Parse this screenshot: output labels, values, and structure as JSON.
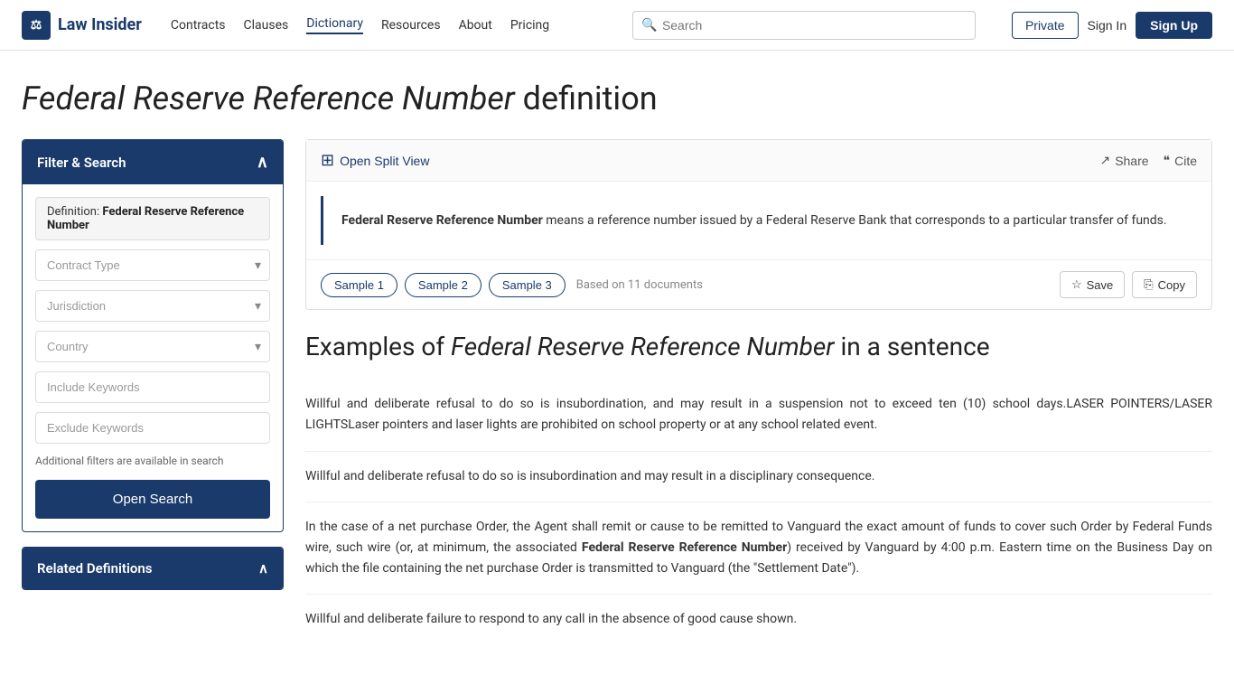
{
  "nav": {
    "logo_text": "Law Insider",
    "logo_icon": "⚖",
    "links": [
      {
        "label": "Contracts",
        "active": false
      },
      {
        "label": "Clauses",
        "active": false
      },
      {
        "label": "Dictionary",
        "active": true
      },
      {
        "label": "Resources",
        "active": false
      },
      {
        "label": "About",
        "active": false
      },
      {
        "label": "Pricing",
        "active": false
      }
    ],
    "search_placeholder": "Search",
    "btn_private": "Private",
    "btn_signin": "Sign In",
    "btn_signup": "Sign Up"
  },
  "page": {
    "title_italic": "Federal Reserve Reference Number",
    "title_suffix": " definition"
  },
  "sidebar": {
    "filter_title": "Filter & Search",
    "definition_label": "Definition:",
    "definition_value": "Federal Reserve Reference Number",
    "contract_type_placeholder": "Contract Type",
    "jurisdiction_placeholder": "Jurisdiction",
    "country_placeholder": "Country",
    "include_keywords_placeholder": "Include Keywords",
    "exclude_keywords_placeholder": "Exclude Keywords",
    "filter_hint": "Additional filters are available in search",
    "open_search_label": "Open Search",
    "related_title": "Related Definitions"
  },
  "content": {
    "split_view_label": "Open Split View",
    "share_label": "Share",
    "cite_label": "Cite",
    "definition_text_bold": "Federal Reserve Reference Number",
    "definition_text_rest": " means a reference number issued by a Federal Reserve Bank that corresponds to a particular transfer of funds.",
    "samples": [
      "Sample 1",
      "Sample 2",
      "Sample 3"
    ],
    "based_on": "Based on 11 documents",
    "save_label": "Save",
    "copy_label": "Copy",
    "examples_title_prefix": "Examples of ",
    "examples_title_italic": "Federal Reserve Reference Number",
    "examples_title_suffix": " in a sentence",
    "examples": [
      "Willful and deliberate refusal to do so is insubordination, and may result in a suspension not to exceed ten (10) school days.LASER POINTERS/LASER LIGHTSLaser pointers and laser lights are prohibited on school property or at any school related event.",
      "Willful and deliberate refusal to do so is insubordination and may result in a disciplinary consequence.",
      "In the case of a net purchase Order, the Agent shall remit or cause to be remitted to Vanguard the exact amount of funds to cover such Order by Federal Funds wire, such wire (or, at minimum, the associated Federal Reserve Reference Number) received by Vanguard by 4:00 p.m. Eastern time on the Business Day on which the file containing the net purchase Order is transmitted to Vanguard (the \"Settlement Date\").",
      "Willful and deliberate failure to respond to any call in the absence of good cause shown."
    ],
    "example_bold_phrase": "Federal Reserve Reference Number"
  },
  "icons": {
    "chevron_up": "∧",
    "chevron_down": "∨",
    "split_view": "⊞",
    "share": "↗",
    "cite": "❝",
    "star": "☆",
    "copy": "⎘",
    "search": "🔍"
  }
}
